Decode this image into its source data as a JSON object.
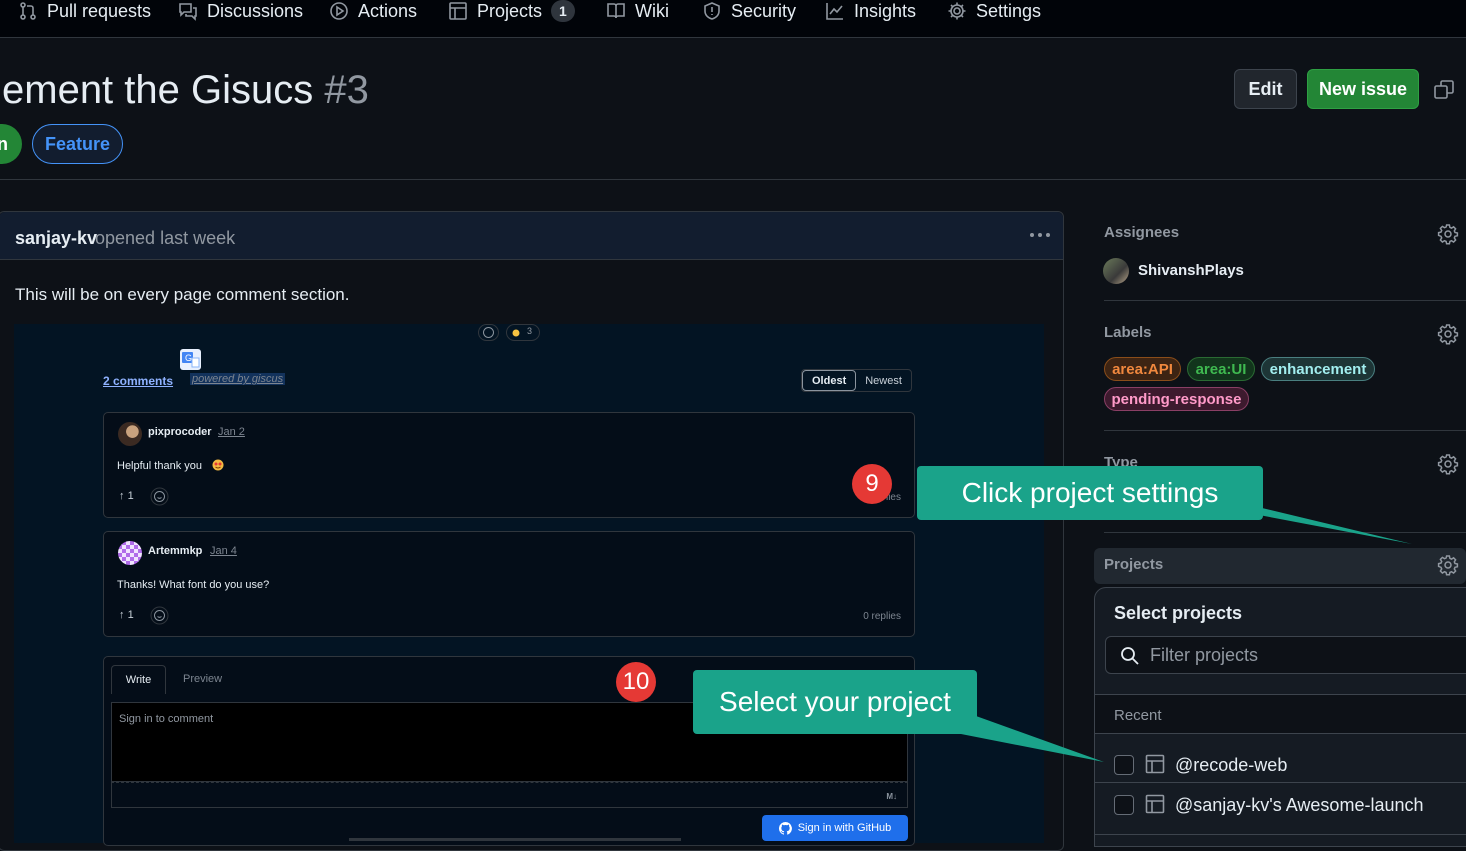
{
  "nav": {
    "items": [
      {
        "label": "Pull requests",
        "icon": "pull-request-icon"
      },
      {
        "label": "Discussions",
        "icon": "discussions-icon"
      },
      {
        "label": "Actions",
        "icon": "play-icon"
      },
      {
        "label": "Projects",
        "icon": "table-icon",
        "count": "1"
      },
      {
        "label": "Wiki",
        "icon": "book-icon"
      },
      {
        "label": "Security",
        "icon": "shield-icon"
      },
      {
        "label": "Insights",
        "icon": "graph-icon"
      },
      {
        "label": "Settings",
        "icon": "gear-icon"
      }
    ]
  },
  "issue": {
    "title": "ement the Gisucs",
    "number": "#3",
    "edit_label": "Edit",
    "new_issue_label": "New issue",
    "status_label": "n",
    "type_label": "Feature"
  },
  "comment": {
    "author": "sanjay-kv",
    "opened": "opened last week",
    "body": "This will be on every page comment section."
  },
  "giscus": {
    "reaction_count": "3",
    "comments_count": "2 comments",
    "powered_by": "powered by giscus",
    "sort_oldest": "Oldest",
    "sort_newest": "Newest",
    "comments": [
      {
        "author": "pixprocoder",
        "date": "Jan 2",
        "text": "Helpful thank you",
        "upvotes": "1",
        "replies": "lies"
      },
      {
        "author": "Artemmkp",
        "date": "Jan 4",
        "text": "Thanks! What font do you use?",
        "upvotes": "1",
        "replies": "0 replies"
      }
    ],
    "tab_write": "Write",
    "tab_preview": "Preview",
    "editor_placeholder": "Sign in to comment",
    "md_badge": "M↓",
    "signin_label": "Sign in with GitHub"
  },
  "annotations": {
    "step9": "9",
    "step9_text": "Click project settings",
    "step10": "10",
    "step10_text": "Select your project",
    "callout_color": "#1aa38a",
    "badge_color": "#e53935"
  },
  "sidebar": {
    "assignees_label": "Assignees",
    "assignee_name": "ShivanshPlays",
    "labels_label": "Labels",
    "labels": [
      {
        "name": "area:API",
        "color": "#e3873b"
      },
      {
        "name": "area:UI",
        "color": "#3fb950"
      },
      {
        "name": "enhancement",
        "color": "#a2eeef"
      },
      {
        "name": "pending-response",
        "color": "#f778ba"
      }
    ],
    "type_label": "Type",
    "projects_label": "Projects",
    "select_projects_title": "Select projects",
    "filter_placeholder": "Filter projects",
    "recent_label": "Recent",
    "projects": [
      {
        "name": "@recode-web"
      },
      {
        "name": "@sanjay-kv's Awesome-launch"
      }
    ]
  }
}
